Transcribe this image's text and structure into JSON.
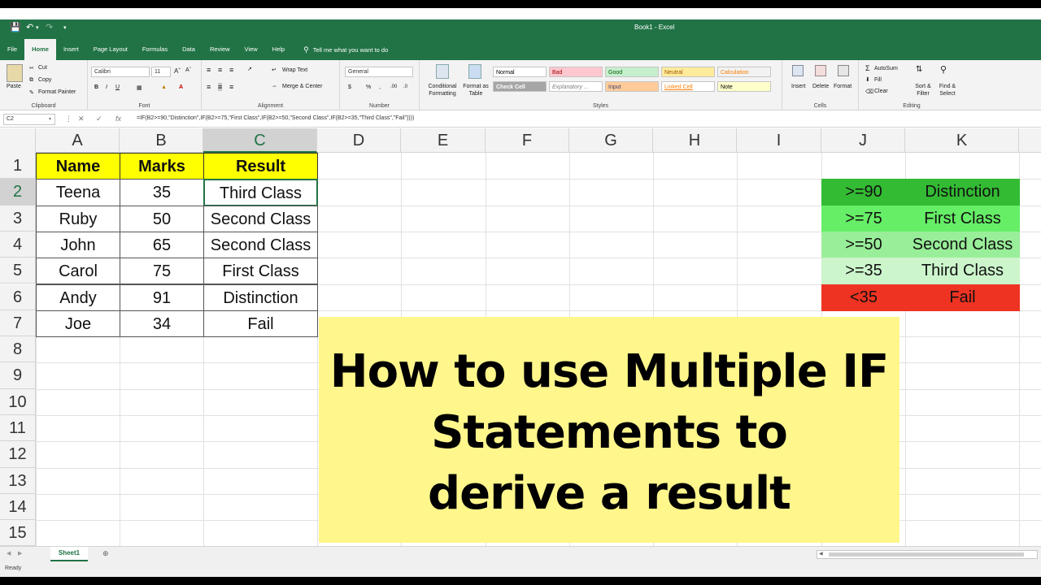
{
  "title_bar": {
    "document_title": "Book1  -  Excel"
  },
  "ribbon_tabs": [
    "File",
    "Home",
    "Insert",
    "Page Layout",
    "Formulas",
    "Data",
    "Review",
    "View",
    "Help"
  ],
  "tell_me": "Tell me what you want to do",
  "clipboard": {
    "paste": "Paste",
    "cut": "Cut",
    "copy": "Copy",
    "format_painter": "Format Painter",
    "label": "Clipboard"
  },
  "font": {
    "name": "Calibri",
    "size": "11",
    "label": "Font"
  },
  "alignment": {
    "wrap_text": "Wrap Text",
    "merge_center": "Merge & Center",
    "label": "Alignment"
  },
  "number": {
    "format": "General",
    "label": "Number"
  },
  "styles": {
    "conditional": "Conditional Formatting",
    "format_as_table": "Format as Table",
    "cells": [
      {
        "label": "Normal",
        "bg": "#ffffff",
        "fg": "#000000"
      },
      {
        "label": "Bad",
        "bg": "#ffc7ce",
        "fg": "#9c0006"
      },
      {
        "label": "Good",
        "bg": "#c6efce",
        "fg": "#006100"
      },
      {
        "label": "Neutral",
        "bg": "#ffeb9c",
        "fg": "#9c5700"
      },
      {
        "label": "Calculation",
        "bg": "#f2f2f2",
        "fg": "#fa7d00"
      },
      {
        "label": "Check Cell",
        "bg": "#a5a5a5",
        "fg": "#ffffff"
      },
      {
        "label": "Explanatory ...",
        "bg": "#ffffff",
        "fg": "#7f7f7f"
      },
      {
        "label": "Input",
        "bg": "#ffcc99",
        "fg": "#3f3f76"
      },
      {
        "label": "Linked Cell",
        "bg": "#ffffff",
        "fg": "#fa7d00"
      },
      {
        "label": "Note",
        "bg": "#ffffcc",
        "fg": "#000000"
      }
    ],
    "label": "Styles"
  },
  "cells_group": {
    "insert": "Insert",
    "delete": "Delete",
    "format": "Format",
    "label": "Cells"
  },
  "editing": {
    "autosum": "AutoSum",
    "fill": "Fill",
    "clear": "Clear",
    "sort_filter": "Sort & Filter",
    "find_select": "Find & Select",
    "label": "Editing"
  },
  "formula_bar": {
    "name_box": "C2",
    "formula": "=IF(B2>=90,\"Distinction\",IF(B2>=75,\"First Class\",IF(B2>=50,\"Second Class\",IF(B2>=35,\"Third Class\",\"Fail\"))))"
  },
  "columns": [
    "A",
    "B",
    "C",
    "D",
    "E",
    "F",
    "G",
    "H",
    "I",
    "J",
    "K"
  ],
  "rows": [
    "1",
    "2",
    "3",
    "4",
    "5",
    "6",
    "7",
    "8",
    "9",
    "10",
    "11",
    "12",
    "13",
    "14",
    "15"
  ],
  "table": {
    "headers": [
      "Name",
      "Marks",
      "Result"
    ],
    "rows": [
      [
        "Teena",
        "35",
        "Third Class"
      ],
      [
        "Ruby",
        "50",
        "Second Class"
      ],
      [
        "John",
        "65",
        "Second Class"
      ],
      [
        "Carol",
        "75",
        "First Class"
      ],
      [
        "Andy",
        "91",
        "Distinction"
      ],
      [
        "Joe",
        "34",
        "Fail"
      ]
    ]
  },
  "legend": [
    {
      "cond": ">=90",
      "result": "Distinction",
      "color": "#33bb33"
    },
    {
      "cond": ">=75",
      "result": "First Class",
      "color": "#66ee66"
    },
    {
      "cond": ">=50",
      "result": "Second Class",
      "color": "#99ee99"
    },
    {
      "cond": ">=35",
      "result": "Third Class",
      "color": "#ccf5cc"
    },
    {
      "cond": "<35",
      "result": "Fail",
      "color": "#ee3322"
    }
  ],
  "banner": {
    "line1": "How to use Multiple IF",
    "line2": "Statements to",
    "line3": "derive a result",
    "bg": "#fff68c"
  },
  "sheet_tab": "Sheet1",
  "status": "Ready"
}
